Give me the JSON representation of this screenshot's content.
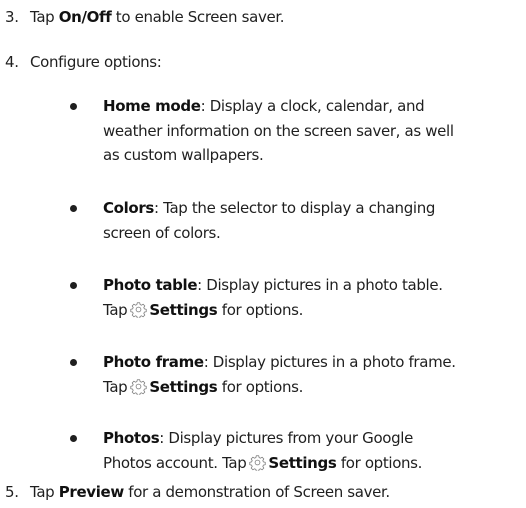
{
  "steps": [
    {
      "num": "3.",
      "pre": "Tap ",
      "bold": "On/Off",
      "post": " to enable Screen saver."
    },
    {
      "num": "4.",
      "pre": "Configure options:",
      "bold": "",
      "post": ""
    },
    {
      "num": "5.",
      "pre": "Tap ",
      "bold": "Preview",
      "post": " for a demonstration of Screen saver."
    }
  ],
  "options": [
    {
      "term": "Home mode",
      "line1": ": Display a clock, calendar, and",
      "line2": "weather information on the screen saver, as well",
      "line3": "as custom wallpapers."
    },
    {
      "term": "Colors",
      "line1": ": Tap the selector to display a changing",
      "line2": "screen of colors."
    },
    {
      "term": "Photo table",
      "line1": ": Display pictures in a photo table.",
      "line2_pre": "Tap",
      "settings": "Settings",
      "line2_post": " for options."
    },
    {
      "term": "Photo frame",
      "line1": ": Display pictures in a photo frame.",
      "line2_pre": "Tap",
      "settings": "Settings",
      "line2_post": " for options."
    },
    {
      "term": "Photos",
      "line1": ": Display pictures from your Google",
      "line2_pre": "Photos account. Tap",
      "settings": "Settings",
      "line2_post": " for options."
    }
  ],
  "icon": "settings-gear-icon"
}
